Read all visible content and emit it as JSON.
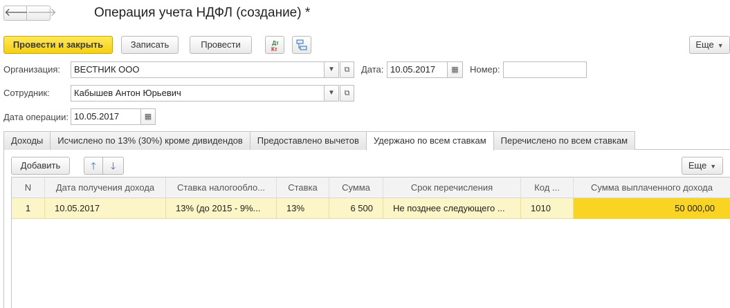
{
  "window": {
    "title": "Операция учета НДФЛ (создание) *"
  },
  "nav": {
    "back": "🡐",
    "forward": "🡒"
  },
  "toolbar": {
    "post_close": "Провести и закрыть",
    "save": "Записать",
    "post": "Провести",
    "dtkt_top": "Дт",
    "dtkt_bottom": "Кт",
    "more": "Еще"
  },
  "form": {
    "org_label": "Организация:",
    "org_value": "ВЕСТНИК ООО",
    "date_label": "Дата:",
    "date_value": "10.05.2017",
    "number_label": "Номер:",
    "number_value": "",
    "employee_label": "Сотрудник:",
    "employee_value": "Кабышев Антон Юрьевич",
    "opdate_label": "Дата операции:",
    "opdate_value": "10.05.2017"
  },
  "tabs": [
    {
      "label": "Доходы"
    },
    {
      "label": "Исчислено по 13% (30%) кроме дивидендов"
    },
    {
      "label": "Предоставлено вычетов"
    },
    {
      "label": "Удержано по всем ставкам",
      "active": true
    },
    {
      "label": "Перечислено по всем ставкам"
    }
  ],
  "table_toolbar": {
    "add": "Добавить",
    "more": "Еще"
  },
  "table": {
    "columns": [
      "N",
      "Дата получения дохода",
      "Ставка налогообло...",
      "Ставка",
      "Сумма",
      "Срок перечисления",
      "Код ...",
      "Сумма выплаченного дохода"
    ],
    "rows": [
      [
        "1",
        "10.05.2017",
        "13% (до 2015 - 9%...",
        "13%",
        "6 500",
        "Не позднее следующего ...",
        "1010",
        "50 000,00"
      ]
    ]
  },
  "colors": {
    "primary_button": "#f5cf12",
    "selected_row": "#fbf5c7",
    "highlight_cell": "#f9d423"
  }
}
